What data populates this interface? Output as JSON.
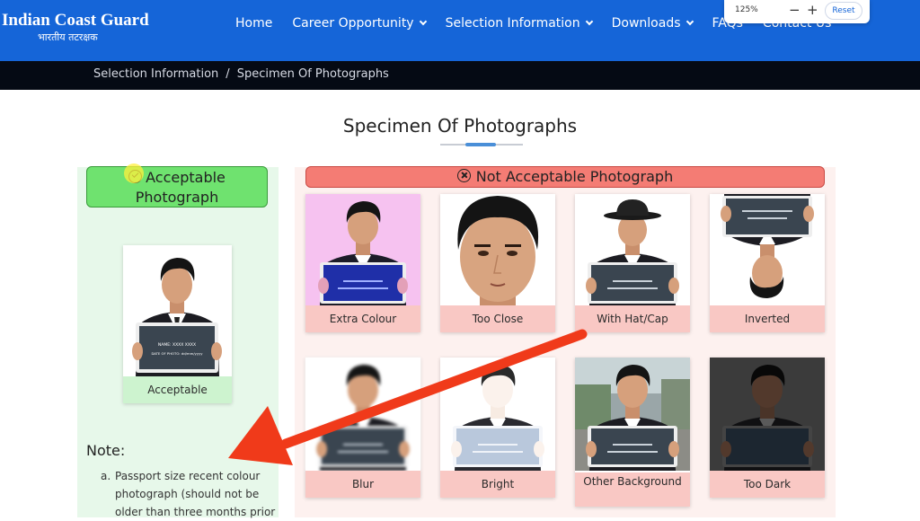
{
  "nav": {
    "brand_title": "Indian Coast Guard",
    "brand_subtitle": "भारतीय तटरक्षक",
    "items": [
      {
        "label": "Home",
        "dropdown": false
      },
      {
        "label": "Career Opportunity",
        "dropdown": true
      },
      {
        "label": "Selection Information",
        "dropdown": true
      },
      {
        "label": "Downloads",
        "dropdown": true
      },
      {
        "label": "FAQs",
        "dropdown": false
      },
      {
        "label": "Contact Us",
        "dropdown": false
      }
    ]
  },
  "zoom": {
    "value": "125%",
    "minus": "−",
    "plus": "+",
    "reset_label": "Reset"
  },
  "breadcrumb": {
    "parent": "Selection Information",
    "separator": "/",
    "current": "Specimen Of Photographs"
  },
  "page_title": "Specimen Of Photographs",
  "acceptable": {
    "heading": "Acceptable Photograph",
    "caption": "Acceptable",
    "board_name": "NAME: XXXX XXXX",
    "board_date": "DATE OF PHOTO: dd/mm/yyyy"
  },
  "not_acceptable": {
    "heading": "Not Acceptable Photograph",
    "items": [
      {
        "caption": "Extra Colour",
        "variant": "pink"
      },
      {
        "caption": "Too Close",
        "variant": "close"
      },
      {
        "caption": "With Hat/Cap",
        "variant": "hat"
      },
      {
        "caption": "Inverted",
        "variant": "inverted"
      },
      {
        "caption": "Blur",
        "variant": "blur"
      },
      {
        "caption": "Bright",
        "variant": "bright"
      },
      {
        "caption": "Other Background",
        "variant": "background"
      },
      {
        "caption": "Too Dark",
        "variant": "dark"
      }
    ]
  },
  "note": {
    "title": "Note:",
    "marker": "a.",
    "text": "Passport size recent colour photograph (should not be older than three months prior"
  },
  "colors": {
    "nav": "#1565d8",
    "accept": "#6fe26f",
    "reject": "#f47c74",
    "arrow": "#f03a1a"
  }
}
